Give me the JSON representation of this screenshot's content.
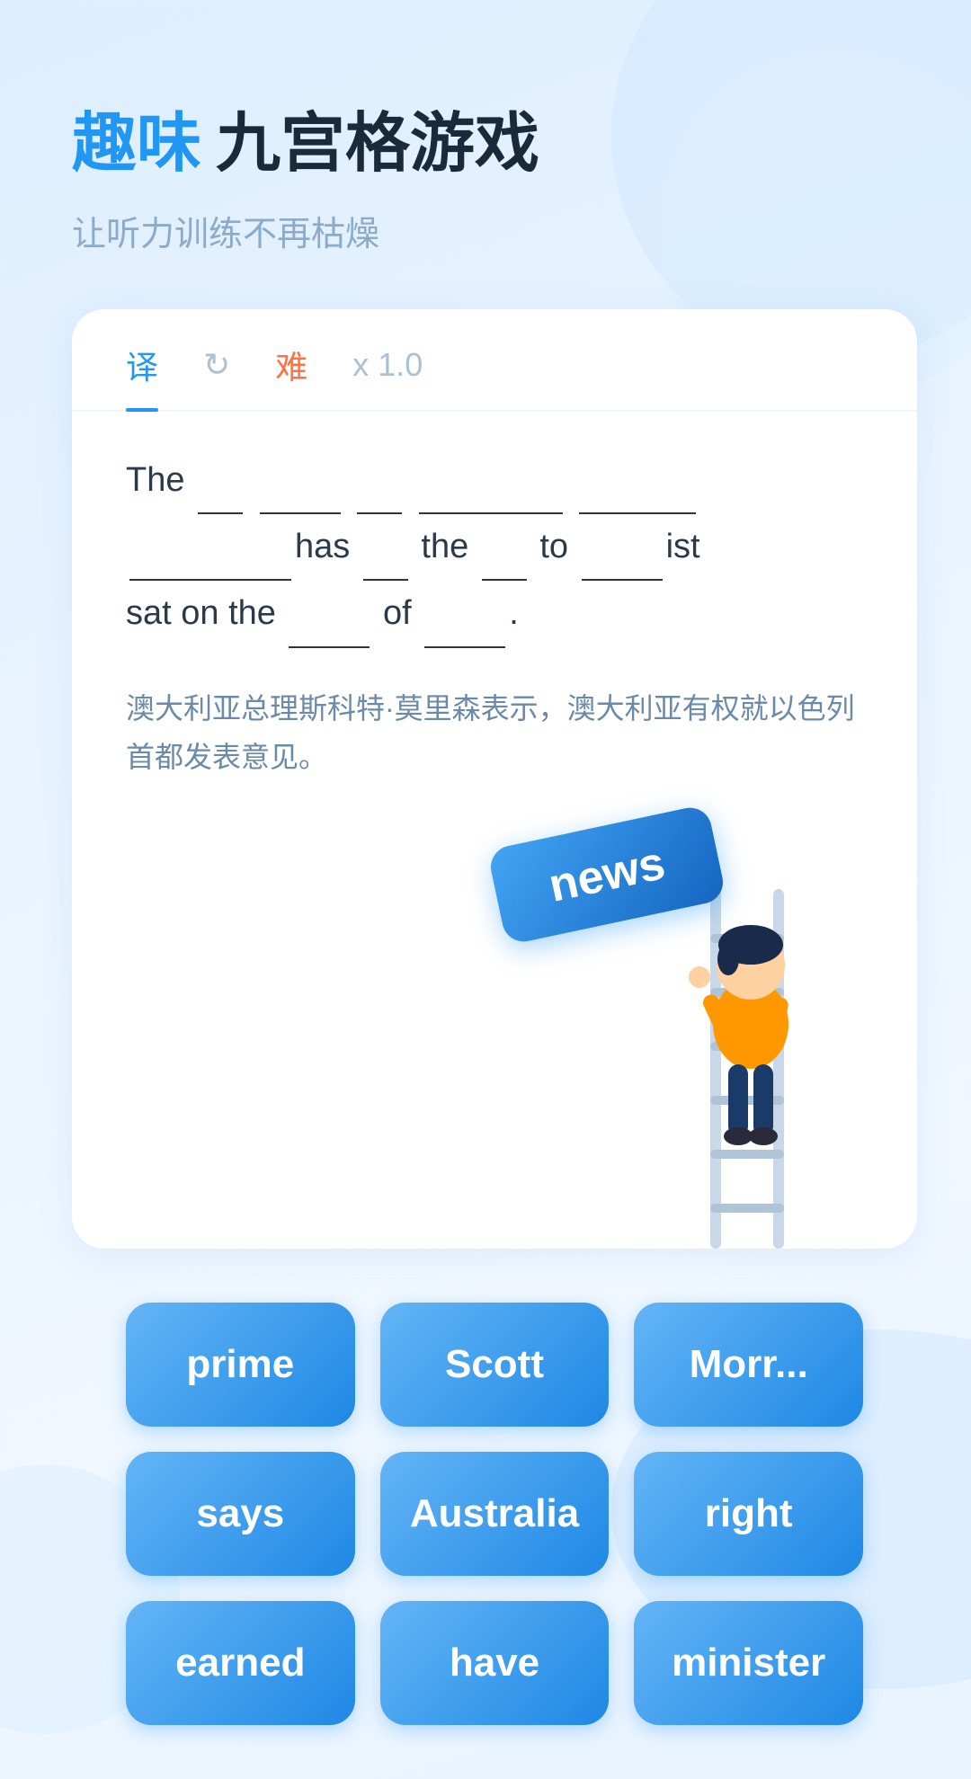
{
  "header": {
    "title_highlight": "趣味",
    "title_main": "九宫格游戏",
    "subtitle": "让听力训练不再枯燥"
  },
  "tabs": [
    {
      "id": "translate",
      "label": "译",
      "active": true
    },
    {
      "id": "refresh",
      "label": "↻",
      "active": false
    },
    {
      "id": "hard",
      "label": "难",
      "active": false
    },
    {
      "id": "speed",
      "label": "x 1.0",
      "active": false
    }
  ],
  "sentence": {
    "parts": [
      "The",
      "___",
      "______",
      "___",
      "__________",
      "_____",
      "________",
      "has",
      "___",
      "the",
      "___",
      "to",
      "_____",
      "ist",
      "sat on the",
      "_____",
      "of",
      "_____."
    ],
    "raw": "The ___ ______ ___ __________ _____ ________has ___ the ___ to _____ist sat on the _____ of _____."
  },
  "translation": "澳大利亚总理斯科特·莫里森表示，澳大利亚有权就以色列首都发表意见。",
  "floating_word": "news",
  "word_grid": [
    {
      "id": "prime",
      "label": "prime"
    },
    {
      "id": "scott",
      "label": "Scott"
    },
    {
      "id": "morrison",
      "label": "Morr..."
    },
    {
      "id": "says",
      "label": "says"
    },
    {
      "id": "australia",
      "label": "Australia"
    },
    {
      "id": "right",
      "label": "right"
    },
    {
      "id": "earned",
      "label": "earned"
    },
    {
      "id": "have",
      "label": "have"
    },
    {
      "id": "minister",
      "label": "minister"
    }
  ]
}
